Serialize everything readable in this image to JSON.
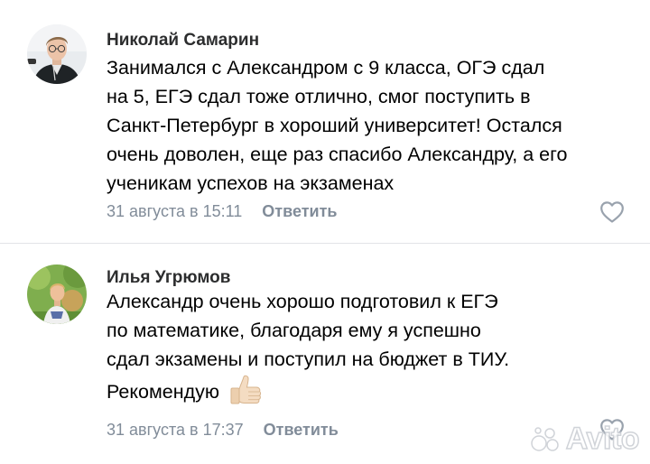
{
  "comments": [
    {
      "author": "Николай Самарин",
      "text_lines": [
        "Занимался с Александром с 9 класса, ОГЭ сдал",
        "на 5, ЕГЭ сдал тоже отлично, смог поступить в",
        "Санкт-Петербург в хороший университет! Остался",
        "очень доволен, еще раз спасибо Александру, а его",
        "ученикам успехов на экзаменах"
      ],
      "date": "31 августа в 15:11",
      "reply_label": "Ответить"
    },
    {
      "author": "Илья Угрюмов",
      "text_lines": [
        "Александр очень хорошо подготовил к ЕГЭ",
        "по математике, благодаря ему я успешно",
        "сдал экзамены и поступил на бюджет в ТИУ.",
        "Рекомендую"
      ],
      "date": "31 августа в 17:37",
      "reply_label": "Ответить"
    }
  ],
  "watermark": "Avito",
  "icons": {
    "like": "heart-outline-icon",
    "emoji": "thumbs-up-emoji"
  },
  "colors": {
    "meta_text": "#818c99",
    "divider": "#e3e4e8",
    "author": "#2c2d2e"
  }
}
